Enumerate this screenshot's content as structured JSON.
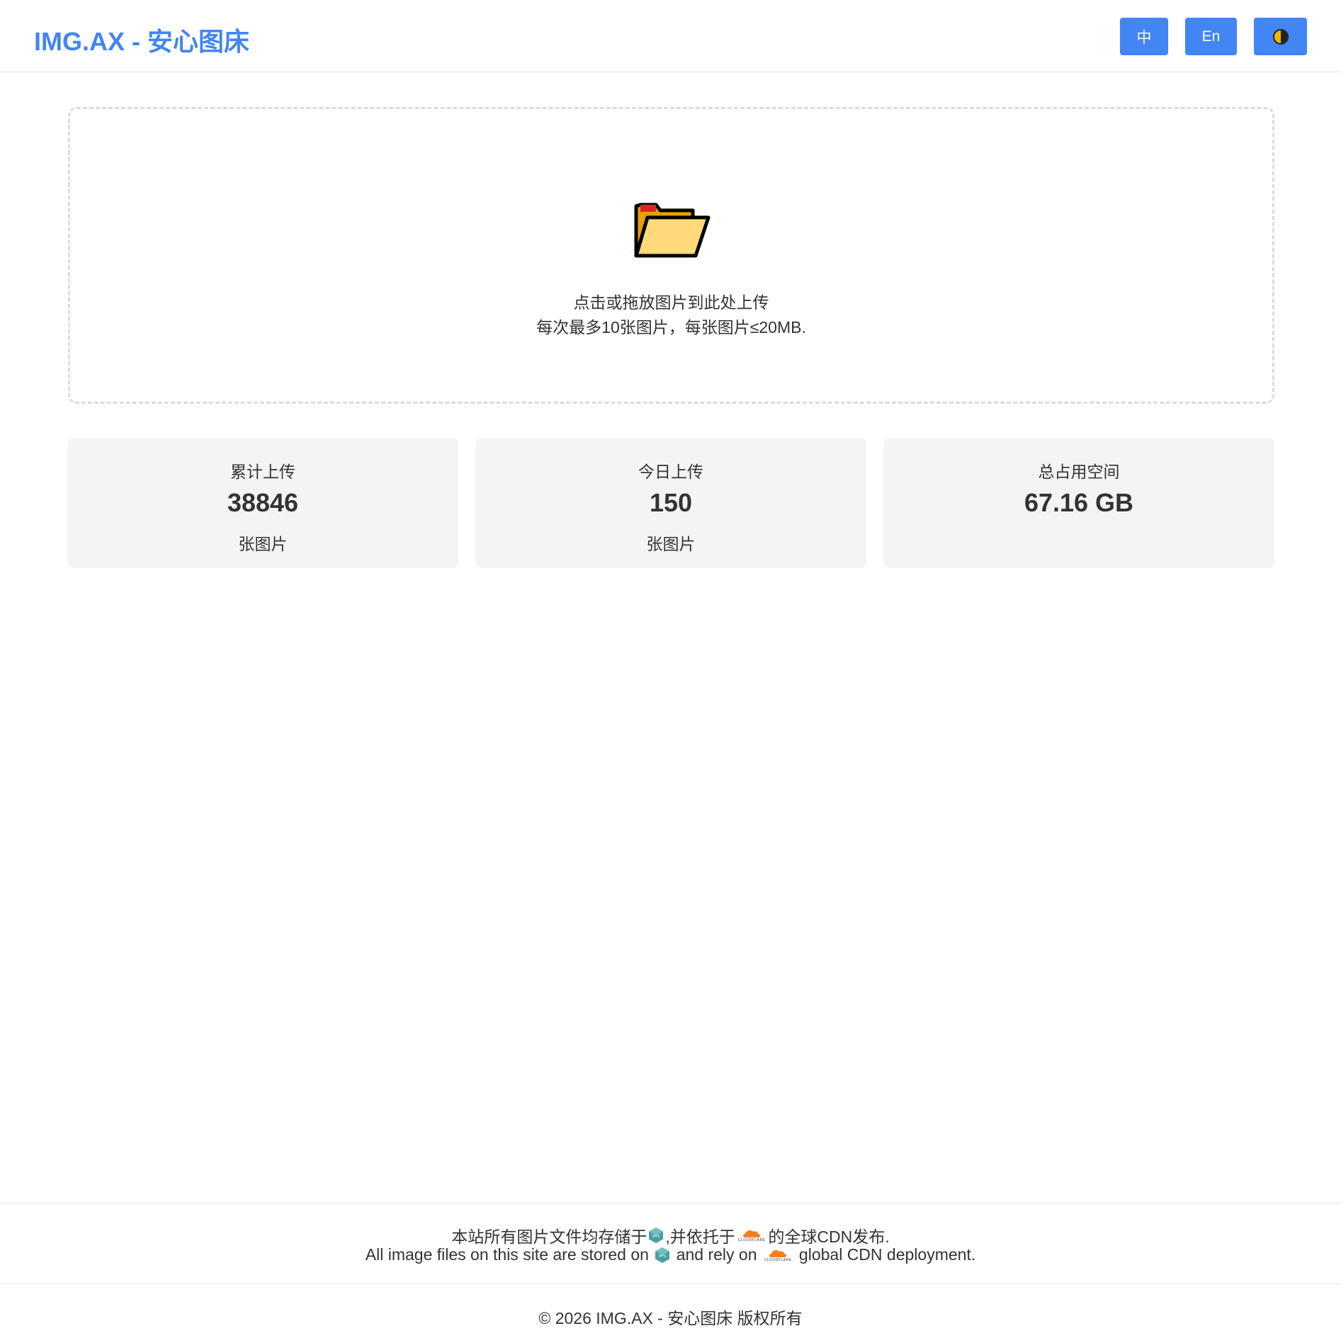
{
  "header": {
    "title": "IMG.AX - 安心图床",
    "lang_zh": "中",
    "lang_en": "En",
    "theme_icon": "theme-toggle-icon"
  },
  "upload": {
    "icon": "folder-icon",
    "line1": "点击或拖放图片到此处上传",
    "line2": "每次最多10张图片，每张图片≤20MB."
  },
  "stats": [
    {
      "label": "累计上传",
      "value": "38846",
      "unit": "张图片"
    },
    {
      "label": "今日上传",
      "value": "150",
      "unit": "张图片"
    },
    {
      "label": "总占用空间",
      "value": "67.16 GB",
      "unit": ""
    }
  ],
  "footer": {
    "zh_part1": "本站所有图片文件均存储于",
    "zh_part2": ",并依托于",
    "zh_part3": "的全球CDN发布.",
    "en_part1": "All image files on this site are stored on",
    "en_part2": "and rely on",
    "en_part3": "global CDN deployment.",
    "ipfs_label": "IPFS",
    "cloudflare_label": "CLOUDFLARE",
    "copyright": "© 2026 IMG.AX - 安心图床 版权所有"
  },
  "colors": {
    "accent": "#4285f4",
    "card_bg": "#f4f4f4",
    "ipfs": "#4a9ea1",
    "cloudflare": "#f38020"
  }
}
